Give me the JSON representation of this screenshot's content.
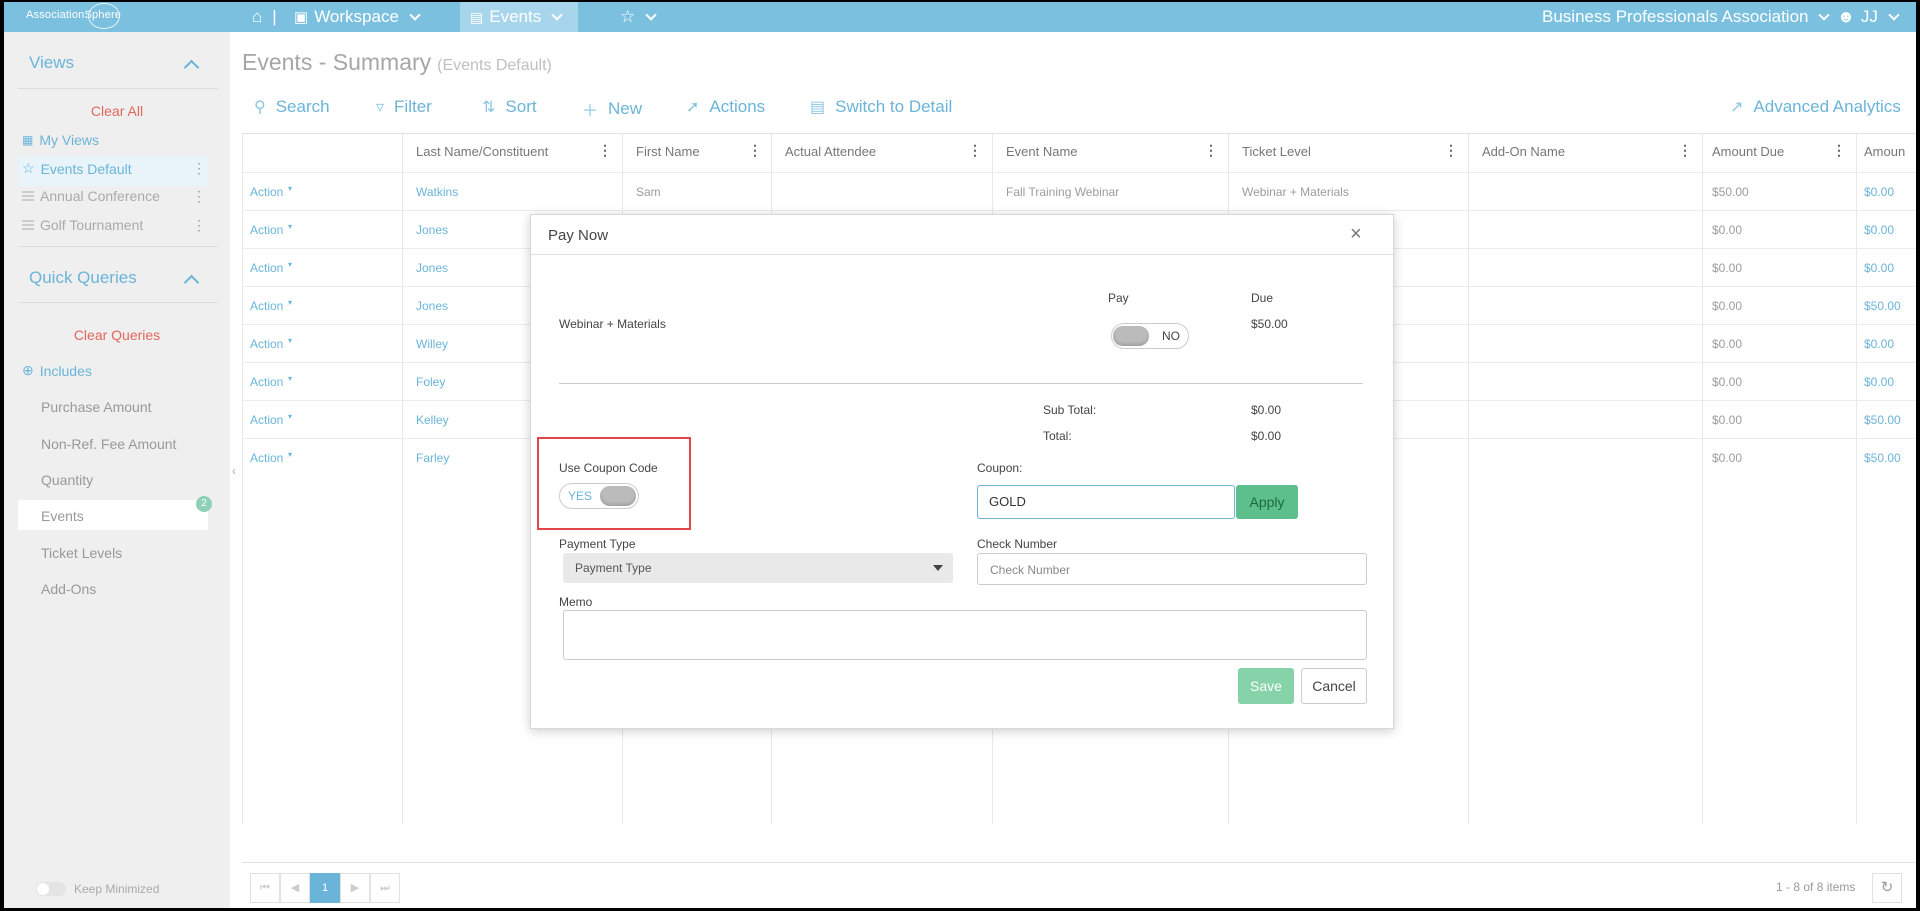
{
  "topbar": {
    "logo_text": "AssociationSphere",
    "workspace_label": "Workspace",
    "events_label": "Events",
    "org_name": "Business Professionals Association",
    "user_initials": "JJ"
  },
  "sidebar": {
    "views_title": "Views",
    "clear_all": "Clear All",
    "view_items": [
      "My Views",
      "Events Default",
      "Annual Conference",
      "Golf Tournament"
    ],
    "quick_queries_title": "Quick Queries",
    "clear_queries": "Clear Queries",
    "includes_label": "Includes",
    "query_items": [
      "Purchase Amount",
      "Non-Ref. Fee Amount",
      "Quantity",
      "Events",
      "Ticket Levels",
      "Add-Ons"
    ],
    "events_badge": "2",
    "keep_minimized": "Keep Minimized"
  },
  "main": {
    "title": "Events - Summary",
    "subtitle": "(Events Default)",
    "toolbar": {
      "search": "Search",
      "filter": "Filter",
      "sort": "Sort",
      "new": "New",
      "actions": "Actions",
      "switch": "Switch to Detail",
      "analytics": "Advanced Analytics"
    }
  },
  "grid": {
    "headers": [
      "Last Name/Constituent",
      "First Name",
      "Actual Attendee",
      "Event Name",
      "Ticket Level",
      "Add-On Name",
      "Amount Due",
      "Amoun"
    ],
    "action_label": "Action",
    "rows": [
      {
        "last": "Watkins",
        "first": "Sam",
        "event": "Fall Training Webinar",
        "ticket": "Webinar + Materials",
        "due": "$50.00",
        "amount": "$0.00"
      },
      {
        "last": "Jones",
        "first": "",
        "event": "",
        "ticket": "",
        "due": "$0.00",
        "amount": "$0.00"
      },
      {
        "last": "Jones",
        "first": "",
        "event": "",
        "ticket": "",
        "due": "$0.00",
        "amount": "$0.00"
      },
      {
        "last": "Jones",
        "first": "",
        "event": "",
        "ticket": "",
        "due": "$0.00",
        "amount": "$50.00"
      },
      {
        "last": "Willey",
        "first": "",
        "event": "",
        "ticket": "",
        "due": "$0.00",
        "amount": "$0.00"
      },
      {
        "last": "Foley",
        "first": "",
        "event": "",
        "ticket": "",
        "due": "$0.00",
        "amount": "$0.00"
      },
      {
        "last": "Kelley",
        "first": "",
        "event": "",
        "ticket": "",
        "due": "$0.00",
        "amount": "$50.00"
      },
      {
        "last": "Farley",
        "first": "",
        "event": "",
        "ticket": "",
        "due": "$0.00",
        "amount": "$50.00"
      }
    ]
  },
  "footer": {
    "page": "1",
    "items_info": "1 - 8 of 8 items"
  },
  "modal": {
    "title": "Pay Now",
    "item_name": "Webinar + Materials",
    "pay_label": "Pay",
    "pay_toggle": "NO",
    "due_label": "Due",
    "due_value": "$50.00",
    "subtotal_label": "Sub Total:",
    "subtotal_value": "$0.00",
    "total_label": "Total:",
    "total_value": "$0.00",
    "use_coupon_label": "Use Coupon Code",
    "use_coupon_toggle": "YES",
    "coupon_label": "Coupon:",
    "coupon_value": "GOLD",
    "apply_label": "Apply",
    "payment_type_label": "Payment Type",
    "payment_type_value": "Payment Type",
    "check_number_label": "Check Number",
    "check_number_placeholder": "Check Number",
    "memo_label": "Memo",
    "save_label": "Save",
    "cancel_label": "Cancel"
  }
}
